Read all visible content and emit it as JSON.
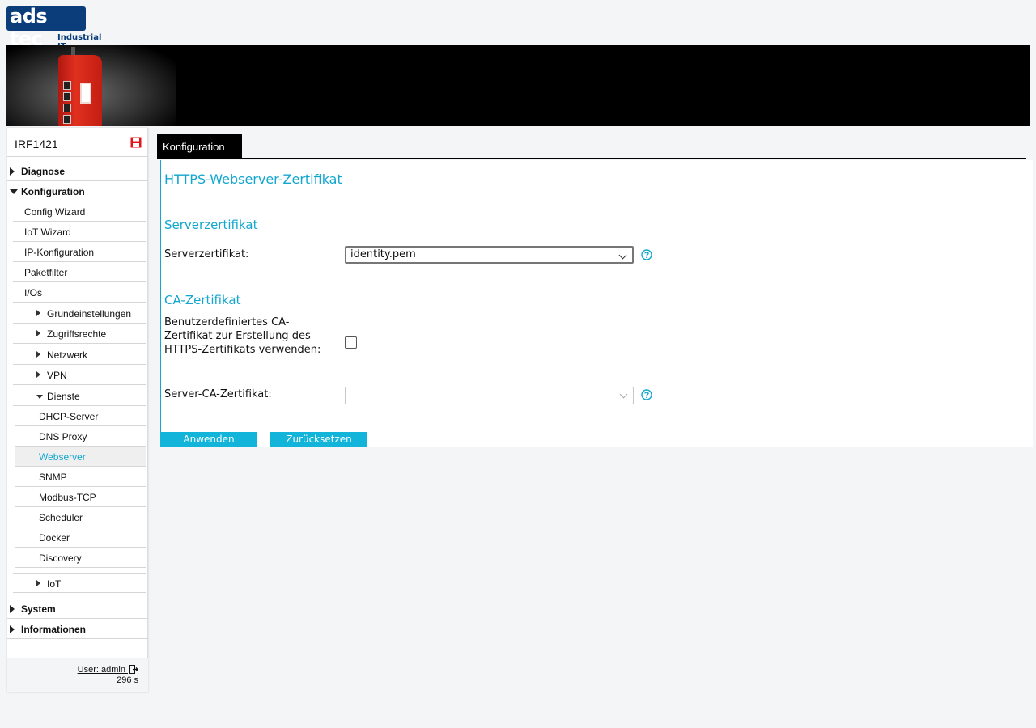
{
  "brand": {
    "logo_text": "ads tec",
    "tagline": "Industrial IT"
  },
  "sidebar": {
    "device_name": "IRF1421",
    "items": [
      {
        "label": "Diagnose"
      },
      {
        "label": "Konfiguration"
      },
      {
        "label": "Config Wizard"
      },
      {
        "label": "IoT Wizard"
      },
      {
        "label": "IP-Konfiguration"
      },
      {
        "label": "Paketfilter"
      },
      {
        "label": "I/Os"
      },
      {
        "label": "Grundeinstellungen"
      },
      {
        "label": "Zugriffsrechte"
      },
      {
        "label": "Netzwerk"
      },
      {
        "label": "VPN"
      },
      {
        "label": "Dienste"
      },
      {
        "label": "DHCP-Server"
      },
      {
        "label": "DNS Proxy"
      },
      {
        "label": "Webserver"
      },
      {
        "label": "SNMP"
      },
      {
        "label": "Modbus-TCP"
      },
      {
        "label": "Scheduler"
      },
      {
        "label": "Docker"
      },
      {
        "label": "Discovery"
      },
      {
        "label": "IoT"
      },
      {
        "label": "System"
      },
      {
        "label": "Informationen"
      }
    ],
    "user_label": "User: admin",
    "timer": "296 s"
  },
  "main": {
    "tab_label": "Konfiguration",
    "title": "HTTPS-Webserver-Zertifikat",
    "section1_title": "Serverzertifikat",
    "server_cert_label": "Serverzertifikat:",
    "server_cert_value": "identity.pem",
    "section2_title": "CA-Zertifikat",
    "custom_ca_label": "Benutzerdefiniertes CA-Zertifikat zur Erstellung des HTTPS-Zertifikats verwenden:",
    "custom_ca_checked": false,
    "server_ca_label": "Server-CA-Zertifikat:",
    "server_ca_value": "",
    "apply_label": "Anwenden",
    "reset_label": "Zurücksetzen"
  },
  "colors": {
    "accent": "#12a7cf",
    "button": "#12b5d9",
    "brand": "#0a3d7a",
    "save_icon": "#e0141e"
  }
}
